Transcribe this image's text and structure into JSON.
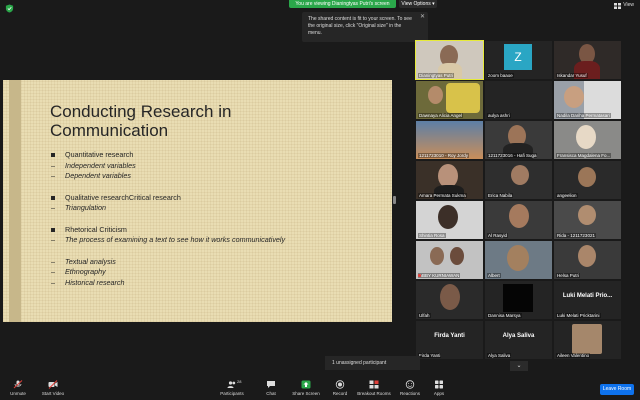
{
  "top": {
    "share_banner": "You are viewing Dianingtyas Putri's screen",
    "view_options": "View Options",
    "view_btn": "View"
  },
  "tooltip": {
    "text": "The shared content is fit to your screen. To see the original size, click \"Original size\" in the menu."
  },
  "slide": {
    "title": "Conducting Research in Communication",
    "items": [
      {
        "t": "Quantitative research",
        "style": "square"
      },
      {
        "t": "Independent variables",
        "style": "dash"
      },
      {
        "t": "Dependent variables",
        "style": "dash"
      },
      {
        "t": "Qualitative researchCritical research",
        "style": "square"
      },
      {
        "t": "Triangulation",
        "style": "dash"
      },
      {
        "t": "Rhetorical Criticism",
        "style": "square"
      },
      {
        "t": "The process of examining a text to see how it works communicatively",
        "style": "dash"
      },
      {
        "t": "Textual analysis",
        "style": "dash"
      },
      {
        "t": "Ethnography",
        "style": "dash"
      },
      {
        "t": "Historical research",
        "style": "dash"
      }
    ]
  },
  "participants": [
    "Dianingtyas Putri",
    "zoom baaoe",
    "Iskandar Yusuf",
    "Dawnaya Alicia Angel",
    "aulya ashri",
    "Nadila Dariha Permatasari",
    "1211723010 - Roy Jordy",
    "1211723016 - Hafi Suga",
    "Fransisca Magdalena Fo...",
    "Amara Permata Sukma",
    "Erica Nabila",
    "angeelion",
    "Shintia Rosa",
    "Al Rasyid",
    "Rida - 1211723021",
    "ABBY KURNIAWAN",
    "Albert",
    "Helsa Putri",
    "Ulfah",
    "Dannisa Marsya",
    "Luki Melati Pricktarini",
    "Firda Yanti",
    "Alya Saliva",
    "Aileen Valentino"
  ],
  "tile_big_names": {
    "luki": "Luki Melati Prio...",
    "firda": "Firda Yanti",
    "alya": "Alya Saliva"
  },
  "zoom_letter": "Z",
  "unassigned": "1 unassigned participant",
  "toolbar": {
    "unmute": "Unmute",
    "start_video": "Start Video",
    "participants": "Participants",
    "participants_count": "28",
    "chat": "Chat",
    "share_screen": "Share Screen",
    "record": "Record",
    "breakout": "Breakout Rooms",
    "reactions": "Reactions",
    "apps": "Apps",
    "leave": "Leave Room"
  },
  "colors": {
    "share_green": "#2aa74a",
    "leave_blue": "#0e72ed",
    "active_speaker": "#e6ea3a"
  }
}
